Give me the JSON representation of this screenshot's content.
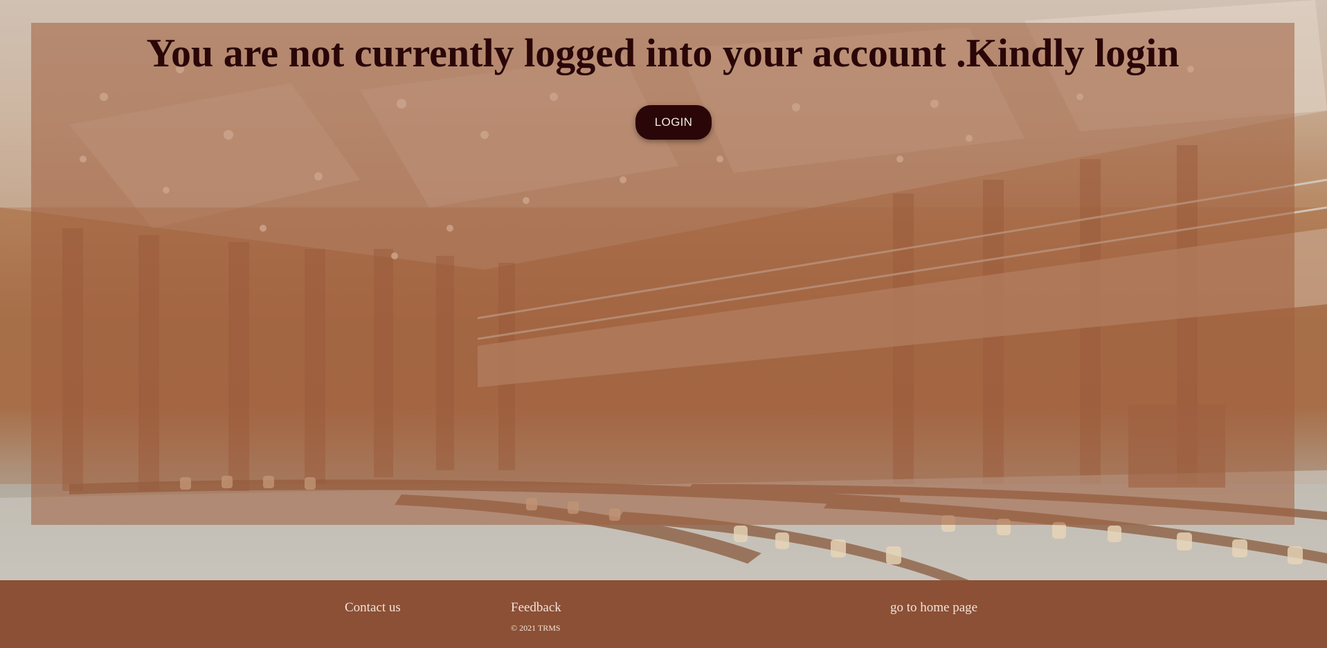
{
  "main": {
    "headline": "You are not currently logged into your account .Kindly login",
    "login_label": "LOGIN"
  },
  "footer": {
    "contact_label": "Contact us",
    "feedback_label": "Feedback",
    "copyright": "© 2021 TRMS",
    "home_label": "go to home page"
  },
  "colors": {
    "headline_text": "#2a0608",
    "button_bg": "#2a0608",
    "footer_bg": "#8b5035",
    "overlay": "#a05f3e"
  }
}
